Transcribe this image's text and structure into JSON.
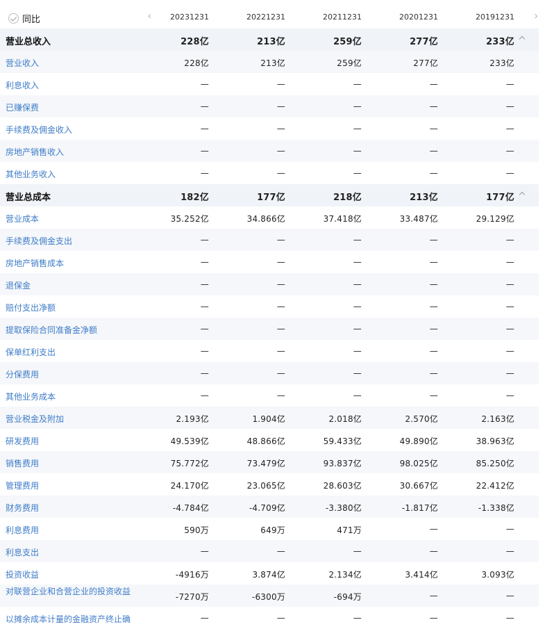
{
  "header": {
    "toggle_label": "同比",
    "periods": [
      "20231231",
      "20221231",
      "20211231",
      "20201231",
      "20191231"
    ]
  },
  "rows": [
    {
      "label": "营业总收入",
      "section": true,
      "values": [
        "228亿",
        "213亿",
        "259亿",
        "277亿",
        "233亿"
      ]
    },
    {
      "label": "营业收入",
      "values": [
        "228亿",
        "213亿",
        "259亿",
        "277亿",
        "233亿"
      ]
    },
    {
      "label": "利息收入",
      "values": [
        "—",
        "—",
        "—",
        "—",
        "—"
      ]
    },
    {
      "label": "已赚保费",
      "values": [
        "—",
        "—",
        "—",
        "—",
        "—"
      ]
    },
    {
      "label": "手续费及佣金收入",
      "values": [
        "—",
        "—",
        "—",
        "—",
        "—"
      ]
    },
    {
      "label": "房地产销售收入",
      "values": [
        "—",
        "—",
        "—",
        "—",
        "—"
      ]
    },
    {
      "label": "其他业务收入",
      "values": [
        "—",
        "—",
        "—",
        "—",
        "—"
      ]
    },
    {
      "label": "营业总成本",
      "section": true,
      "values": [
        "182亿",
        "177亿",
        "218亿",
        "213亿",
        "177亿"
      ]
    },
    {
      "label": "营业成本",
      "values": [
        "35.252亿",
        "34.866亿",
        "37.418亿",
        "33.487亿",
        "29.129亿"
      ]
    },
    {
      "label": "手续费及佣金支出",
      "values": [
        "—",
        "—",
        "—",
        "—",
        "—"
      ]
    },
    {
      "label": "房地产销售成本",
      "values": [
        "—",
        "—",
        "—",
        "—",
        "—"
      ]
    },
    {
      "label": "退保金",
      "values": [
        "—",
        "—",
        "—",
        "—",
        "—"
      ]
    },
    {
      "label": "赔付支出净额",
      "values": [
        "—",
        "—",
        "—",
        "—",
        "—"
      ]
    },
    {
      "label": "提取保险合同准备金净额",
      "values": [
        "—",
        "—",
        "—",
        "—",
        "—"
      ]
    },
    {
      "label": "保单红利支出",
      "values": [
        "—",
        "—",
        "—",
        "—",
        "—"
      ]
    },
    {
      "label": "分保费用",
      "values": [
        "—",
        "—",
        "—",
        "—",
        "—"
      ]
    },
    {
      "label": "其他业务成本",
      "values": [
        "—",
        "—",
        "—",
        "—",
        "—"
      ]
    },
    {
      "label": "营业税金及附加",
      "values": [
        "2.193亿",
        "1.904亿",
        "2.018亿",
        "2.570亿",
        "2.163亿"
      ]
    },
    {
      "label": "研发费用",
      "values": [
        "49.539亿",
        "48.866亿",
        "59.433亿",
        "49.890亿",
        "38.963亿"
      ]
    },
    {
      "label": "销售费用",
      "values": [
        "75.772亿",
        "73.479亿",
        "93.837亿",
        "98.025亿",
        "85.250亿"
      ]
    },
    {
      "label": "管理费用",
      "values": [
        "24.170亿",
        "23.065亿",
        "28.603亿",
        "30.667亿",
        "22.412亿"
      ]
    },
    {
      "label": "财务费用",
      "values": [
        "-4.784亿",
        "-4.709亿",
        "-3.380亿",
        "-1.817亿",
        "-1.338亿"
      ]
    },
    {
      "label": "利息费用",
      "values": [
        "590万",
        "649万",
        "471万",
        "—",
        "—"
      ]
    },
    {
      "label": "利息支出",
      "values": [
        "—",
        "—",
        "—",
        "—",
        "—"
      ]
    },
    {
      "label": "投资收益",
      "values": [
        "-4916万",
        "3.874亿",
        "2.134亿",
        "3.414亿",
        "3.093亿"
      ]
    },
    {
      "label": "对联营企业和合营企业的投资收益",
      "tall": true,
      "values": [
        "-7270万",
        "-6300万",
        "-694万",
        "—",
        "—"
      ]
    },
    {
      "label": "以摊余成本计量的金融资产终止确",
      "values": [
        "—",
        "—",
        "—",
        "—",
        "—"
      ]
    }
  ]
}
